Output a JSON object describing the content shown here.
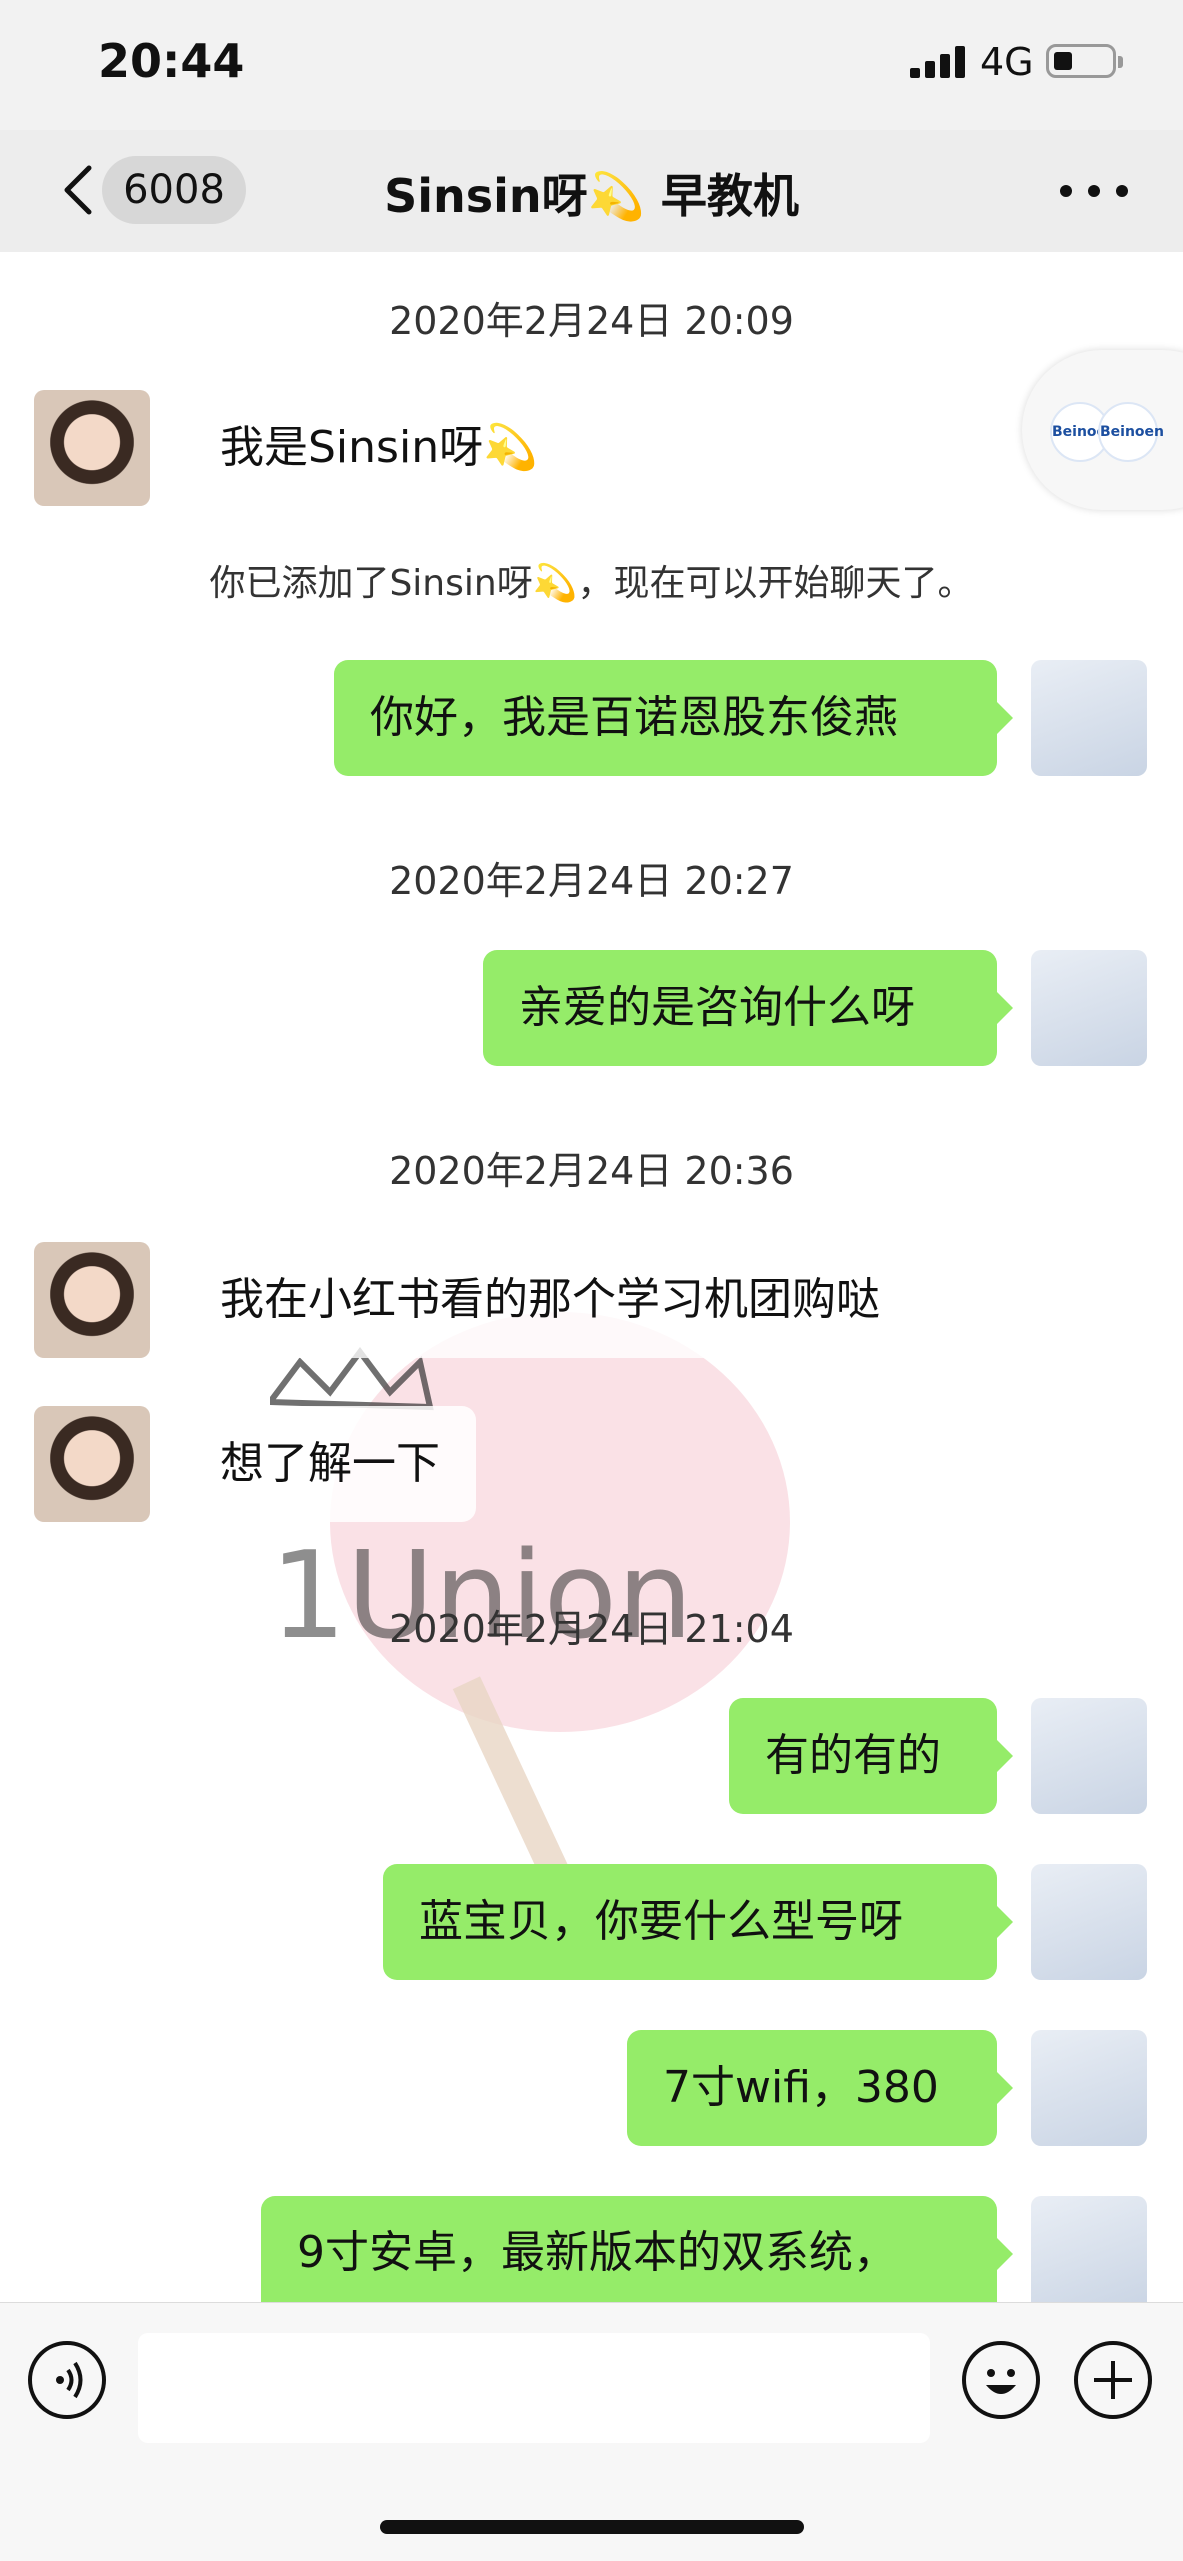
{
  "status_bar": {
    "time": "20:44",
    "network": "4G"
  },
  "nav": {
    "unread_count": "6008",
    "title": "Sinsin呀💫 早教机"
  },
  "messages": [
    {
      "kind": "timestamp",
      "text": "2020年2月24日 20:09"
    },
    {
      "kind": "in",
      "text": "我是Sinsin呀💫"
    },
    {
      "kind": "system",
      "text": "你已添加了Sinsin呀💫，现在可以开始聊天了。"
    },
    {
      "kind": "out",
      "text": "你好，我是百诺恩股东俊燕"
    },
    {
      "kind": "timestamp",
      "text": "2020年2月24日 20:27"
    },
    {
      "kind": "out",
      "text": "亲爱的是咨询什么呀"
    },
    {
      "kind": "timestamp",
      "text": "2020年2月24日 20:36"
    },
    {
      "kind": "in",
      "text": "我在小红书看的那个学习机团购哒"
    },
    {
      "kind": "in",
      "text": "想了解一下"
    },
    {
      "kind": "timestamp",
      "text": "2020年2月24日 21:04"
    },
    {
      "kind": "out",
      "text": "有的有的"
    },
    {
      "kind": "out",
      "text": "蓝宝贝，你要什么型号呀"
    },
    {
      "kind": "out",
      "text": "7寸wifi，380"
    },
    {
      "kind": "out",
      "text": "9寸安卓，最新版本的双系统，"
    }
  ],
  "floating_badge": {
    "brand": "Beinoen"
  },
  "colors": {
    "outgoing_bubble": "#95ec69",
    "incoming_bubble": "#ffffff",
    "nav_bg": "#ededed"
  }
}
